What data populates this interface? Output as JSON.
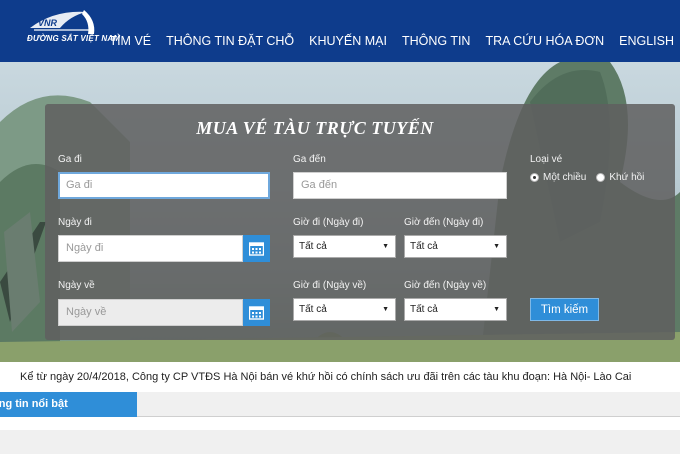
{
  "header": {
    "logo_text": "ĐƯỜNG SẮT VIỆT NAM",
    "logo_letters": "VNR",
    "nav": [
      {
        "label": "TÌM VÉ"
      },
      {
        "label": "THÔNG TIN ĐẶT CHỖ"
      },
      {
        "label": "KHUYẾN MẠI"
      },
      {
        "label": "THÔNG TIN"
      },
      {
        "label": "TRA CỨU HÓA ĐƠN"
      },
      {
        "label": "ENGLISH"
      }
    ]
  },
  "search": {
    "title": "MUA VÉ TÀU TRỰC TUYẾN",
    "from_label": "Ga đi",
    "from_placeholder": "Ga đi",
    "to_label": "Ga đến",
    "to_placeholder": "Ga đến",
    "ticket_type_label": "Loại vé",
    "one_way": "Một chiều",
    "round_trip": "Khứ hồi",
    "depart_date_label": "Ngày đi",
    "depart_date_placeholder": "Ngày đi",
    "depart_time_label": "Giờ đi (Ngày đi)",
    "depart_time_value": "Tất cả",
    "arrive_time_label": "Giờ đến (Ngày đi)",
    "arrive_time_value": "Tất cả",
    "return_date_label": "Ngày về",
    "return_date_placeholder": "Ngày về",
    "return_depart_time_label": "Giờ đi (Ngày về)",
    "return_depart_time_value": "Tất cả",
    "return_arrive_time_label": "Giờ đến (Ngày về)",
    "return_arrive_time_value": "Tất cả",
    "search_button": "Tìm kiếm"
  },
  "news": {
    "ticker": "Kể từ ngày 20/4/2018, Công ty CP VTĐS Hà Nội bán vé khứ hồi có chính sách ưu đãi trên các tàu khu đoạn: Hà Nội- Lào Cai",
    "highlight_tab": "ông tin nổi bật"
  },
  "colors": {
    "header_bg": "#0e3c8c",
    "accent": "#2f8ed8",
    "panel_bg": "rgba(95,95,95,0.86)"
  }
}
